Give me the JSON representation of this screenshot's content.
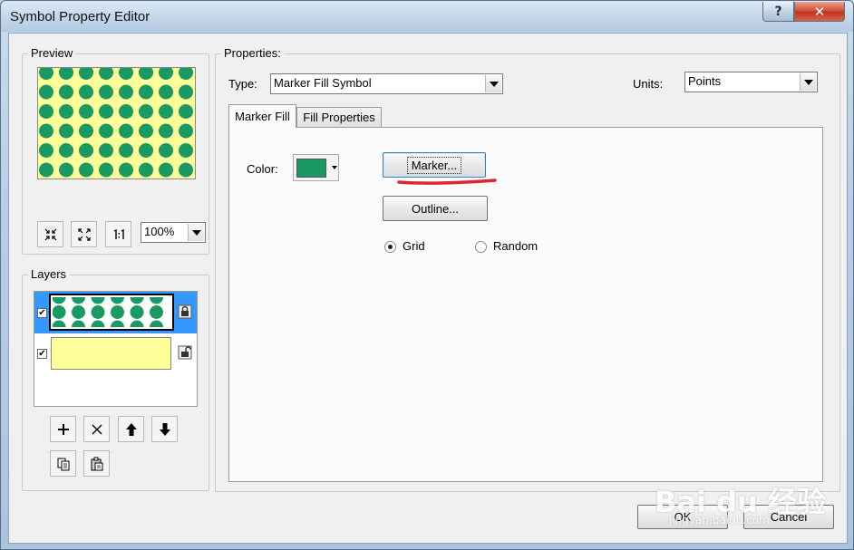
{
  "window": {
    "title": "Symbol Property Editor",
    "help_label": "?",
    "close_label": "✕"
  },
  "preview": {
    "legend": "Preview",
    "zoom": "100%",
    "fill_color": "#ffff99",
    "marker_color": "#1a9a63"
  },
  "layers": {
    "legend": "Layers",
    "items": [
      {
        "checked": true,
        "kind": "marker-fill",
        "selected": true
      },
      {
        "checked": true,
        "kind": "simple-fill",
        "selected": false
      }
    ]
  },
  "properties": {
    "legend": "Properties:",
    "type_label": "Type:",
    "type_value": "Marker Fill Symbol",
    "units_label": "Units:",
    "units_value": "Points"
  },
  "tabs": [
    {
      "label": "Marker Fill"
    },
    {
      "label": "Fill Properties"
    }
  ],
  "marker_fill": {
    "color_label": "Color:",
    "color_value": "#1a9a63",
    "marker_button": "Marker...",
    "outline_button": "Outline...",
    "grid_label": "Grid",
    "random_label": "Random"
  },
  "footer": {
    "ok_label": "OK",
    "cancel_label": "Cancel"
  },
  "watermark": {
    "brand": "Bai du 经验",
    "url": "jingyan.baidu.com"
  }
}
